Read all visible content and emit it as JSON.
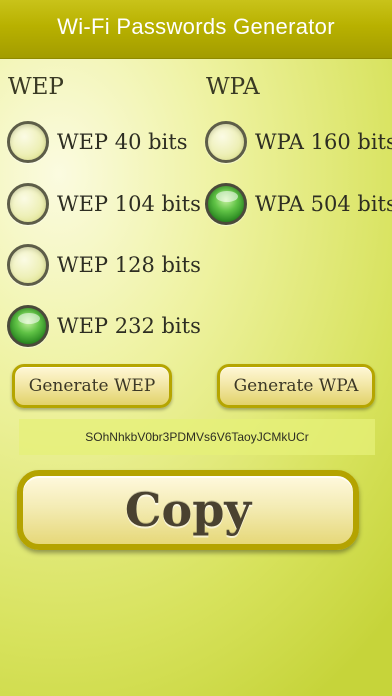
{
  "header": {
    "title": "Wi-Fi Passwords Generator"
  },
  "wep": {
    "heading": "WEP",
    "options": [
      {
        "label": "WEP 40 bits",
        "checked": false
      },
      {
        "label": "WEP 104 bits",
        "checked": false
      },
      {
        "label": "WEP 128 bits",
        "checked": false
      },
      {
        "label": "WEP 232 bits",
        "checked": true
      }
    ],
    "generate_label": "Generate WEP"
  },
  "wpa": {
    "heading": "WPA",
    "options": [
      {
        "label": "WPA 160 bits",
        "checked": false
      },
      {
        "label": "WPA 504 bits",
        "checked": true
      }
    ],
    "generate_label": "Generate WPA"
  },
  "password": {
    "value": "SOhNhkbV0br3PDMVs6V6TaoyJCMkUCr"
  },
  "copy": {
    "label": "Copy"
  }
}
